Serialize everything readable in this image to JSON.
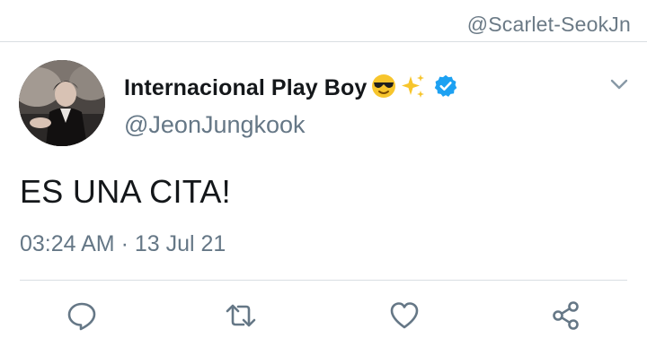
{
  "watermark": "@Scarlet-SeokJn",
  "tweet": {
    "display_name": "Internacional Play Boy",
    "name_emojis": [
      "sunglasses-emoji",
      "sparkles-emoji"
    ],
    "verified": true,
    "handle": "@JeonJungkook",
    "text": "ES UNA CITA!",
    "time": "03:24 AM",
    "separator": "·",
    "date": "13 Jul 21"
  },
  "actions": [
    {
      "name": "reply",
      "icon": "reply-icon"
    },
    {
      "name": "retweet",
      "icon": "retweet-icon"
    },
    {
      "name": "like",
      "icon": "heart-icon"
    },
    {
      "name": "share",
      "icon": "share-icon"
    }
  ],
  "colors": {
    "verified_badge": "#1da1f2",
    "icon_gray": "#657786",
    "text": "#14171a",
    "divider": "#d9dee2"
  }
}
